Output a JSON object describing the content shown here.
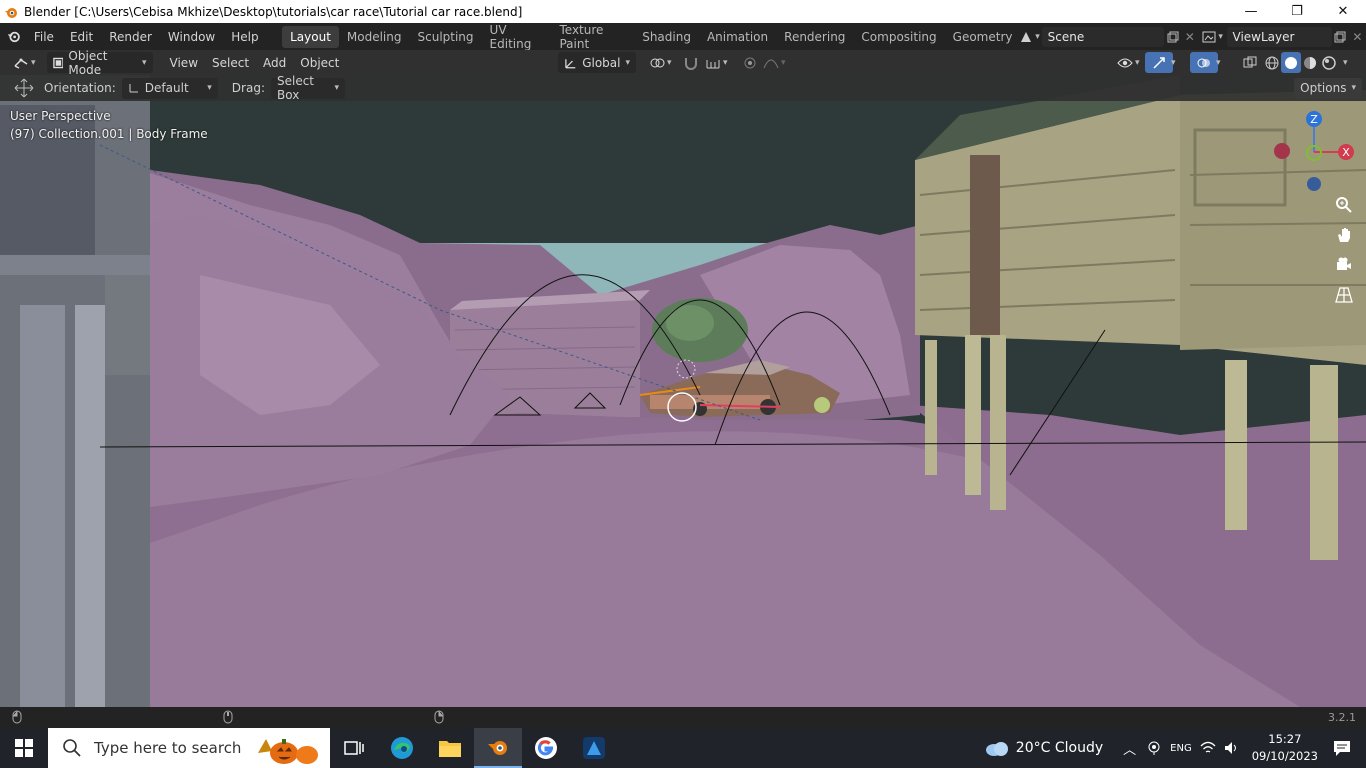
{
  "window": {
    "title": "Blender [C:\\Users\\Cebisa Mkhize\\Desktop\\tutorials\\car race\\Tutorial car race.blend]",
    "minimize_glyph": "—",
    "maximize_glyph": "❐",
    "close_glyph": "✕"
  },
  "topbar": {
    "menus": [
      "File",
      "Edit",
      "Render",
      "Window",
      "Help"
    ],
    "workspaces": [
      "Layout",
      "Modeling",
      "Sculpting",
      "UV Editing",
      "Texture Paint",
      "Shading",
      "Animation",
      "Rendering",
      "Compositing",
      "Geometry Noc"
    ],
    "active_workspace": "Layout",
    "scene": "Scene",
    "view_layer": "ViewLayer"
  },
  "header": {
    "mode": "Object Mode",
    "menus": [
      "View",
      "Select",
      "Add",
      "Object"
    ],
    "transform_orientation": "Global"
  },
  "tool_options": {
    "orientation_label": "Orientation:",
    "orientation_value": "Default",
    "drag_label": "Drag:",
    "drag_value": "Select Box",
    "options_label": "Options"
  },
  "viewport": {
    "perspective": "User Perspective",
    "collection": "(97) Collection.001 | Body Frame",
    "gizmo": {
      "z": "Z",
      "x": "X"
    }
  },
  "statusbar": {
    "version": "3.2.1"
  },
  "taskbar": {
    "search_placeholder": "Type here to search",
    "weather": "20°C  Cloudy",
    "time": "15:27",
    "date": "09/10/2023",
    "lang": "ENG"
  },
  "colors": {
    "terrain": "#9a7d9c",
    "house": "#a9a583",
    "sky": "#2e3a39",
    "accent": "#4772b3"
  }
}
